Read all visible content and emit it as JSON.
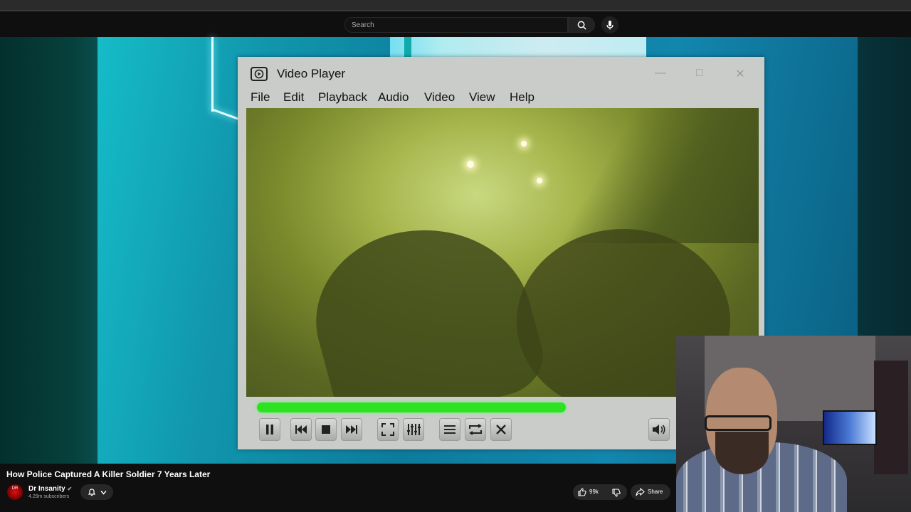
{
  "search": {
    "placeholder": "Search"
  },
  "player": {
    "title": "Video Player",
    "menu": [
      "File",
      "Edit",
      "Playback",
      "Audio",
      "Video",
      "View",
      "Help"
    ],
    "progress_percent": 62,
    "accent_color": "#2de321",
    "controls": [
      "pause-icon",
      "previous-icon",
      "stop-icon",
      "next-icon",
      "fullscreen-icon",
      "equalizer-icon",
      "playlist-icon",
      "repeat-icon",
      "shuffle-icon",
      "volume-icon"
    ]
  },
  "video": {
    "title": "How Police Captured A Killer Soldier 7 Years Later",
    "channel": "Dr Insanity",
    "subscribers": "4.29m subscribers",
    "avatar_text": "DR",
    "likes": "99k",
    "share_label": "Share"
  }
}
